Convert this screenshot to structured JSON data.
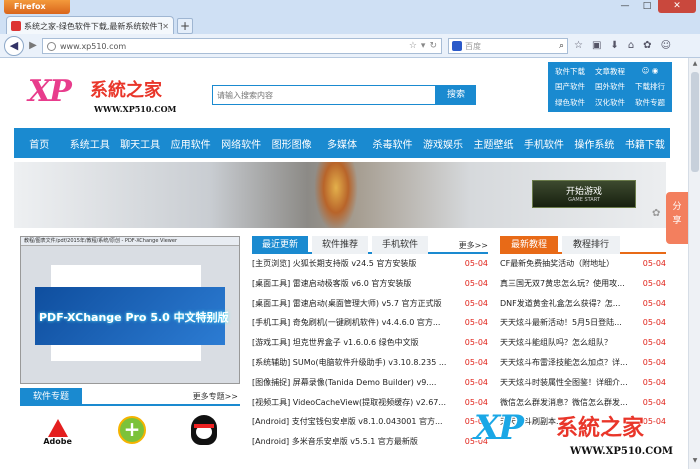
{
  "browser": {
    "app_button": "Firefox",
    "tab_title": "系统之家-绿色软件下载,最新系统软件下...",
    "new_tab": "+",
    "url": "www.xp510.com",
    "search_placeholder": "百度",
    "window_buttons": [
      "—",
      "□",
      "✕"
    ],
    "toolbar_icons": [
      "bookmark-star-icon",
      "bookmarks-icon",
      "download-icon",
      "home-icon",
      "addon-icon",
      "feedback-icon"
    ]
  },
  "site": {
    "logo_xp": "XP",
    "logo_cn": "系統之家",
    "logo_url": "WWW.XP510.COM",
    "search_placeholder": "请输入搜索内容",
    "search_button": "搜索",
    "toplinks": [
      "软件下载",
      "文章教程",
      "",
      "国产软件",
      "国外软件",
      "下载排行",
      "绿色软件",
      "汉化软件",
      "软件专题"
    ],
    "nav": [
      "首页",
      "系统工具",
      "聊天工具",
      "应用软件",
      "网络软件",
      "图形图像",
      "多媒体",
      "杀毒软件",
      "游戏娱乐",
      "主题壁纸",
      "手机软件",
      "操作系统",
      "书籍下载"
    ],
    "banner_button": "开始游戏",
    "banner_button_sub": "GAME START",
    "share": [
      "分",
      "享"
    ]
  },
  "showcase": {
    "window_title": "教程/图表文件/pdf/2015年/教程/系统/原创 - PDF-XChange Viewer",
    "caption": "PDF-XChange Pro 5.0 中文特别版"
  },
  "special": {
    "tab": "软件专题",
    "more": "更多专题>>",
    "icons": [
      "Adobe",
      "",
      ""
    ]
  },
  "middle": {
    "tabs": [
      "最近更新",
      "软件推荐",
      "手机软件"
    ],
    "more": "更多>>",
    "items": [
      {
        "title": "[主页浏览] 火狐长期支持版 v24.5 官方安装版",
        "date": "05-04"
      },
      {
        "title": "[桌面工具] 雷速启动极客版 v6.0 官方安装版",
        "date": "05-04"
      },
      {
        "title": "[桌面工具] 雷速启动(桌面管理大师) v5.7 官方正式版",
        "date": "05-04"
      },
      {
        "title": "[手机工具] 奇兔刷机(一键刷机软件) v4.4.6.0 官方...",
        "date": "05-04"
      },
      {
        "title": "[游戏工具] 坦克世界盒子 v1.6.0.6 绿色中文版",
        "date": "05-04"
      },
      {
        "title": "[系统辅助] SUMo(电脑软件升级助手) v3.10.8.235 ...",
        "date": "05-04"
      },
      {
        "title": "[图像捕捉] 屏幕录像(Tanida Demo Builder) v9....",
        "date": "05-04"
      },
      {
        "title": "[视频工具] VideoCacheView(提取视频缓存) v2.67...",
        "date": "05-04"
      },
      {
        "title": "[Android] 支付宝钱包安卓版 v8.1.0.043001 官方...",
        "date": "05-04"
      },
      {
        "title": "[Android] 多米音乐安卓版 v5.5.1 官方最新版",
        "date": "05-04"
      }
    ]
  },
  "right": {
    "tabs": [
      "最新教程",
      "教程排行"
    ],
    "items": [
      {
        "title": "CF最新免费抽奖活动（附地址）",
        "date": "05-04"
      },
      {
        "title": "真三国无双7黄忠怎么玩？使用攻...",
        "date": "05-04"
      },
      {
        "title": "DNF发道黄金礼盒怎么获得？怎...",
        "date": "05-04"
      },
      {
        "title": "天天炫斗最新活动！5月5日登陆...",
        "date": "05-04"
      },
      {
        "title": "天天炫斗能组队吗？怎么组队？",
        "date": "05-04"
      },
      {
        "title": "天天炫斗布雷泽技能怎么加点？详...",
        "date": "05-04"
      },
      {
        "title": "天天炫斗时装属性全图鉴！详细介...",
        "date": "05-04"
      },
      {
        "title": "微信怎么群发消息？微信怎么群发...",
        "date": "05-04"
      },
      {
        "title": "天天炫斗刷副本...",
        "date": "05-04"
      },
      {
        "title": "",
        "date": ""
      }
    ]
  },
  "floating_logo": {
    "xp": "XP",
    "cn": "系統之家",
    "url": "WWW.XP510.COM"
  }
}
